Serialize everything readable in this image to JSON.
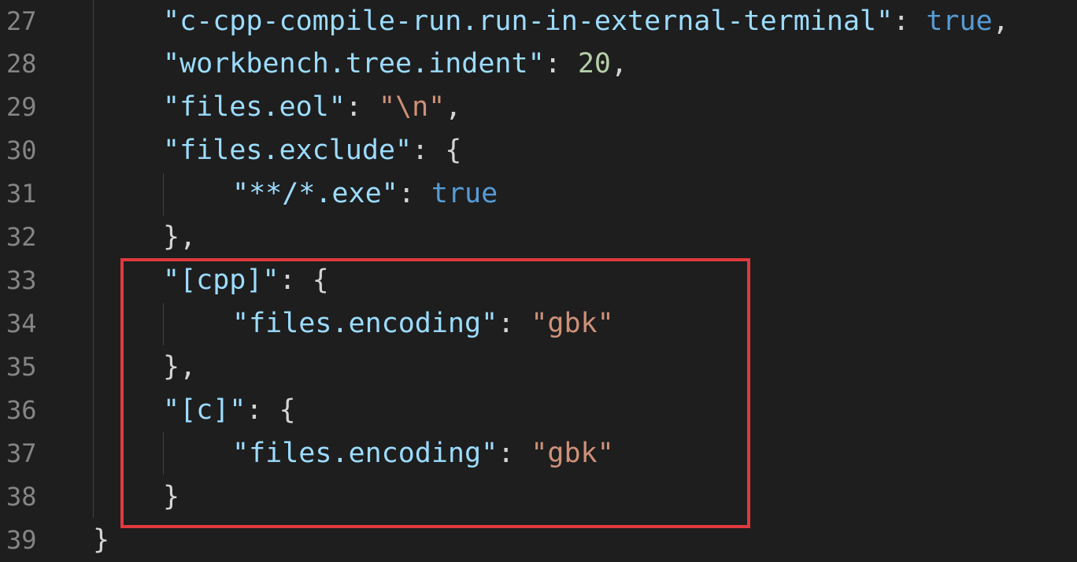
{
  "editor": {
    "lines": [
      {
        "num": "27",
        "tokens": [
          {
            "text": "\"c-cpp-compile-run.run-in-external-terminal\"",
            "cls": "key"
          },
          {
            "text": ": ",
            "cls": "pun"
          },
          {
            "text": "true",
            "cls": "kw"
          },
          {
            "text": ",",
            "cls": "pun"
          }
        ]
      },
      {
        "num": "28",
        "tokens": [
          {
            "text": "\"workbench.tree.indent\"",
            "cls": "key"
          },
          {
            "text": ": ",
            "cls": "pun"
          },
          {
            "text": "20",
            "cls": "num"
          },
          {
            "text": ",",
            "cls": "pun"
          }
        ]
      },
      {
        "num": "29",
        "tokens": [
          {
            "text": "\"files.eol\"",
            "cls": "key"
          },
          {
            "text": ": ",
            "cls": "pun"
          },
          {
            "text": "\"\\n\"",
            "cls": "str"
          },
          {
            "text": ",",
            "cls": "pun"
          }
        ]
      },
      {
        "num": "30",
        "tokens": [
          {
            "text": "\"files.exclude\"",
            "cls": "key"
          },
          {
            "text": ": {",
            "cls": "pun"
          }
        ]
      },
      {
        "num": "31",
        "tokens": [
          {
            "text": "\"**/*.exe\"",
            "cls": "key"
          },
          {
            "text": ": ",
            "cls": "pun"
          },
          {
            "text": "true",
            "cls": "kw"
          }
        ]
      },
      {
        "num": "32",
        "tokens": [
          {
            "text": "},",
            "cls": "pun"
          }
        ]
      },
      {
        "num": "33",
        "tokens": [
          {
            "text": "\"[cpp]\"",
            "cls": "key"
          },
          {
            "text": ": {",
            "cls": "pun"
          }
        ]
      },
      {
        "num": "34",
        "tokens": [
          {
            "text": "\"files.encoding\"",
            "cls": "key"
          },
          {
            "text": ": ",
            "cls": "pun"
          },
          {
            "text": "\"gbk\"",
            "cls": "str"
          }
        ]
      },
      {
        "num": "35",
        "tokens": [
          {
            "text": "},",
            "cls": "pun"
          }
        ]
      },
      {
        "num": "36",
        "tokens": [
          {
            "text": "\"[c]\"",
            "cls": "key"
          },
          {
            "text": ": {",
            "cls": "pun"
          }
        ]
      },
      {
        "num": "37",
        "tokens": [
          {
            "text": "\"files.encoding\"",
            "cls": "key"
          },
          {
            "text": ": ",
            "cls": "pun"
          },
          {
            "text": "\"gbk\"",
            "cls": "str"
          }
        ]
      },
      {
        "num": "38",
        "tokens": [
          {
            "text": "}",
            "cls": "pun"
          }
        ]
      },
      {
        "num": "39",
        "tokens": [
          {
            "text": "}",
            "cls": "pun"
          }
        ]
      }
    ]
  },
  "colors": {
    "background": "#1e1e1e",
    "line_number": "#858585",
    "json_key": "#9cdcfe",
    "string": "#ce9178",
    "number": "#b5cea8",
    "keyword": "#569cd6",
    "highlight_border": "#e0393e"
  }
}
